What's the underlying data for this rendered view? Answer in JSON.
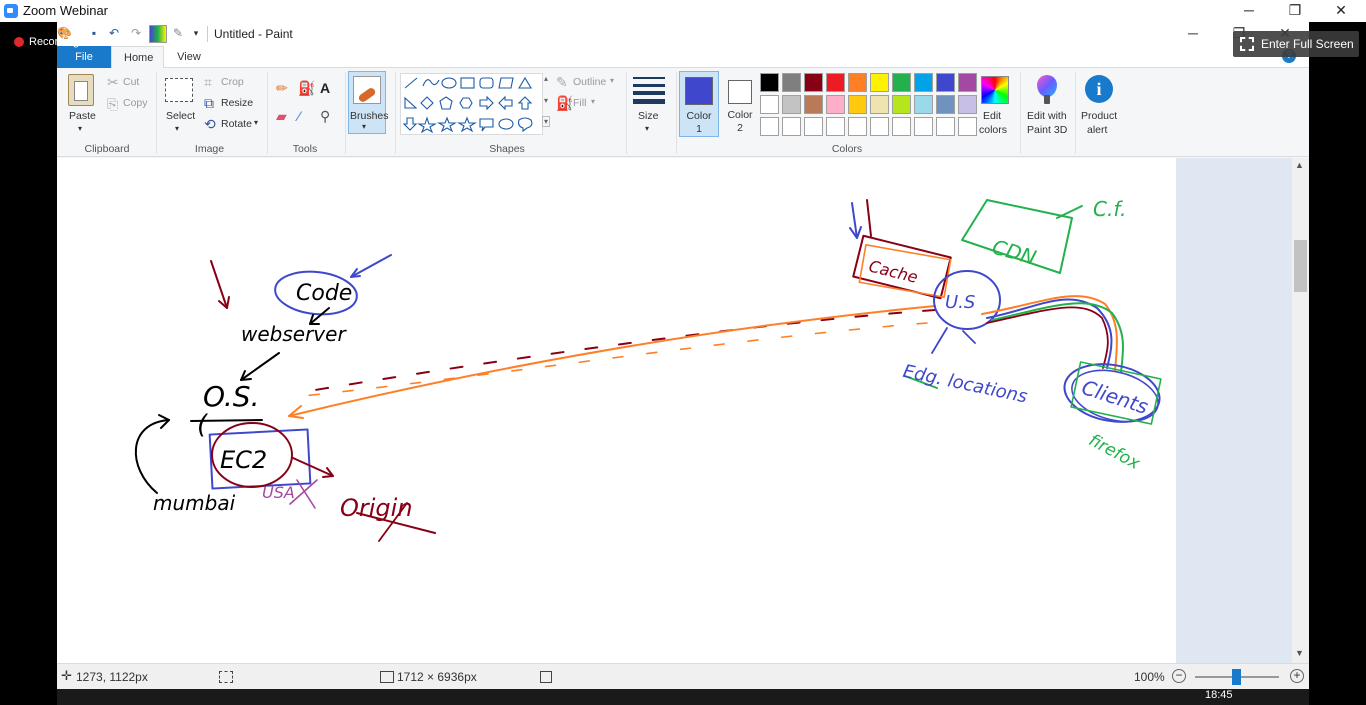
{
  "zoom": {
    "title": "Zoom Webinar",
    "recording_label": "Recording",
    "fullscreen_label": "Enter Full Screen",
    "minimize": "─",
    "restore": "❐",
    "close": "✕"
  },
  "paint": {
    "title": "Untitled - Paint",
    "tabs": [
      "File",
      "Home",
      "View"
    ],
    "clipboard": {
      "paste": "Paste",
      "cut": "Cut",
      "copy": "Copy",
      "group": "Clipboard"
    },
    "image": {
      "select": "Select",
      "crop": "Crop",
      "resize": "Resize",
      "rotate": "Rotate",
      "group": "Image"
    },
    "tools": {
      "group": "Tools"
    },
    "brushes": "Brushes",
    "shapes": {
      "outline": "Outline",
      "fill": "Fill",
      "group": "Shapes"
    },
    "size": "Size",
    "color1": {
      "label": "Color",
      "num": "1",
      "value": "#3f48cc"
    },
    "color2": {
      "label": "Color",
      "num": "2",
      "value": "#ffffff"
    },
    "colors_group": "Colors",
    "edit_colors": [
      "Edit",
      "colors"
    ],
    "edit_3d": [
      "Edit with",
      "Paint 3D"
    ],
    "product_alert": [
      "Product",
      "alert"
    ],
    "palette_row1": [
      "#000000",
      "#7f7f7f",
      "#880015",
      "#ed1c24",
      "#ff7f27",
      "#fff200",
      "#22b14c",
      "#00a2e8",
      "#3f48cc",
      "#a349a4"
    ],
    "palette_row2": [
      "#ffffff",
      "#c3c3c3",
      "#b97a57",
      "#ffaec9",
      "#ffc90e",
      "#efe4b0",
      "#b5e61d",
      "#99d9ea",
      "#7092be",
      "#c8bfe7"
    ],
    "palette_row3": [
      "#ffffff",
      "#ffffff",
      "#ffffff",
      "#ffffff",
      "#ffffff",
      "#ffffff",
      "#ffffff",
      "#ffffff",
      "#ffffff",
      "#ffffff"
    ]
  },
  "canvas_text": {
    "code": "Code",
    "webserver": "webserver",
    "os": "O.S.",
    "ec2": "EC2",
    "mumbai": "mumbai",
    "origin": "Origin",
    "cache": "Cache",
    "us": "U.S",
    "cdn": "CDN",
    "cf": "C.f.",
    "edge_locations": "Edg. locations",
    "clients": "Clients",
    "firefox": "firefox",
    "usa": "USA"
  },
  "status": {
    "cursor_pos": "1273, 1122px",
    "image_size": "1712 × 6936px",
    "zoom": "100%"
  },
  "taskbar": {
    "time": "18:45"
  }
}
